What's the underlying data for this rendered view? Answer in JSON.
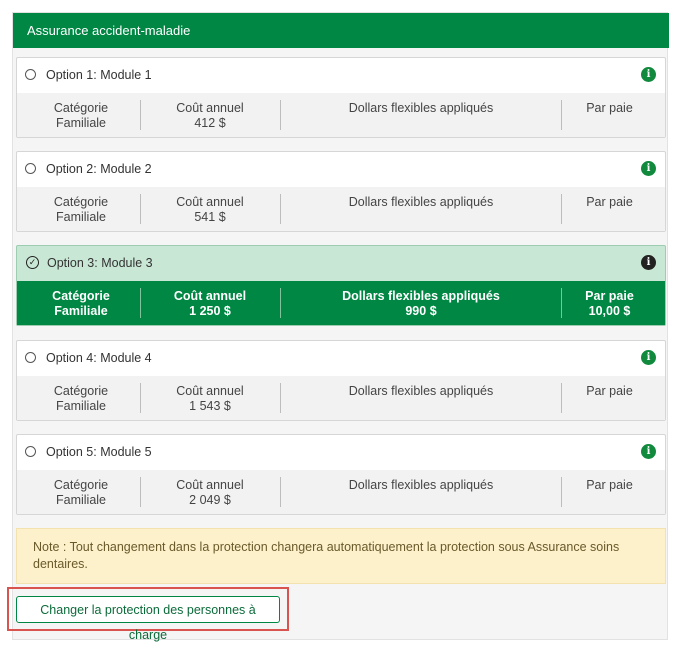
{
  "header": {
    "title": "Assurance accident-maladie"
  },
  "columns": {
    "categorie": "Catégorie",
    "cout": "Coût annuel",
    "dollars": "Dollars flexibles appliqués",
    "paie": "Par paie"
  },
  "options": [
    {
      "title": "Option 1: Module 1",
      "categorie": "Familiale",
      "cout": "412 $",
      "dollars": "",
      "paie": "",
      "selected": false
    },
    {
      "title": "Option 2: Module 2",
      "categorie": "Familiale",
      "cout": "541 $",
      "dollars": "",
      "paie": "",
      "selected": false
    },
    {
      "title": "Option 3: Module 3",
      "categorie": "Familiale",
      "cout": "1 250 $",
      "dollars": "990 $",
      "paie": "10,00 $",
      "selected": true
    },
    {
      "title": "Option 4: Module 4",
      "categorie": "Familiale",
      "cout": "1 543 $",
      "dollars": "",
      "paie": "",
      "selected": false
    },
    {
      "title": "Option 5: Module 5",
      "categorie": "Familiale",
      "cout": "2 049 $",
      "dollars": "",
      "paie": "",
      "selected": false
    }
  ],
  "note": {
    "text": "Note : Tout changement dans la protection changera automatiquement la protection sous Assurance soins dentaires."
  },
  "actions": {
    "change_dependents": "Changer la protection des personnes à charge"
  },
  "colors": {
    "brand_green": "#008744",
    "selected_bg": "#c9e7d5",
    "note_bg": "#fdf1cc",
    "highlight_red": "#d9534f"
  },
  "icons": {
    "info": "info-icon",
    "radio": "radio-unchecked-icon",
    "checked": "check-circle-icon"
  }
}
